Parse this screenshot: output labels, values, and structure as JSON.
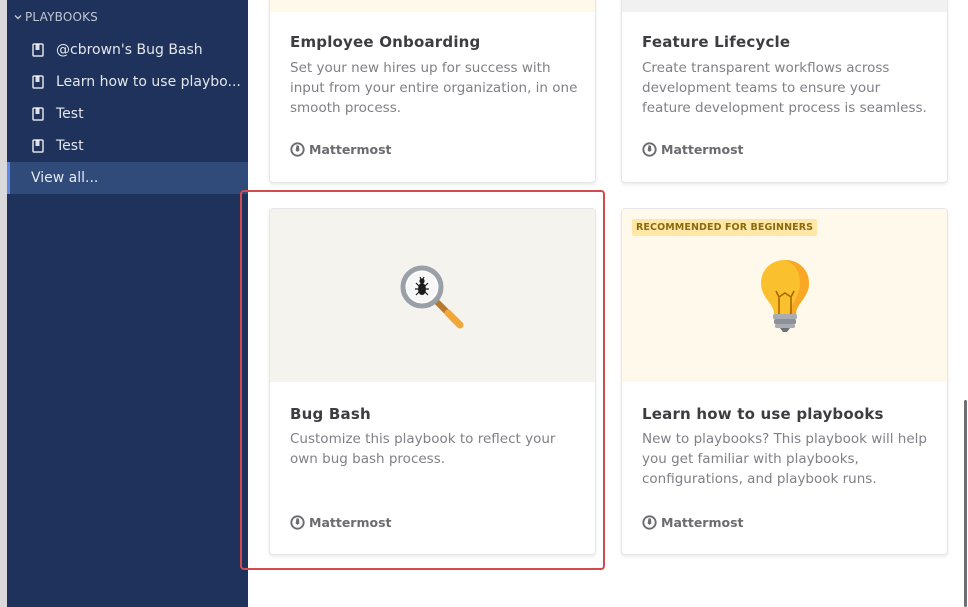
{
  "sidebar": {
    "section_label": "PLAYBOOKS",
    "items": [
      {
        "label": "@cbrown's Bug Bash",
        "icon": "book-icon"
      },
      {
        "label": "Learn how to use playbo...",
        "icon": "book-icon"
      },
      {
        "label": "Test",
        "icon": "book-icon"
      },
      {
        "label": "Test",
        "icon": "book-icon"
      }
    ],
    "view_all": "View all..."
  },
  "cards": [
    {
      "title": "Employee Onboarding",
      "description": "Set your new hires up for success with input from your entire organization, in one smooth process.",
      "brand": "Mattermost"
    },
    {
      "title": "Feature Lifecycle",
      "description": "Create transparent workflows across development teams to ensure your feature development process is seamless.",
      "brand": "Mattermost"
    },
    {
      "title": "Bug Bash",
      "description": "Customize this playbook to reflect your own bug bash process.",
      "brand": "Mattermost",
      "icon": "magnifier-bug-icon"
    },
    {
      "title": "Learn how to use playbooks",
      "description": "New to playbooks? This playbook will help you get familiar with playbooks, configurations, and playbook runs.",
      "brand": "Mattermost",
      "badge": "RECOMMENDED FOR BEGINNERS",
      "icon": "lightbulb-icon"
    }
  ],
  "colors": {
    "sidebar_bg": "#1e325c",
    "sidebar_active": "#304a7a",
    "highlight_border": "#d24b4e",
    "banner_cream": "#fef9ea",
    "banner_grey": "#f5f3ed"
  }
}
